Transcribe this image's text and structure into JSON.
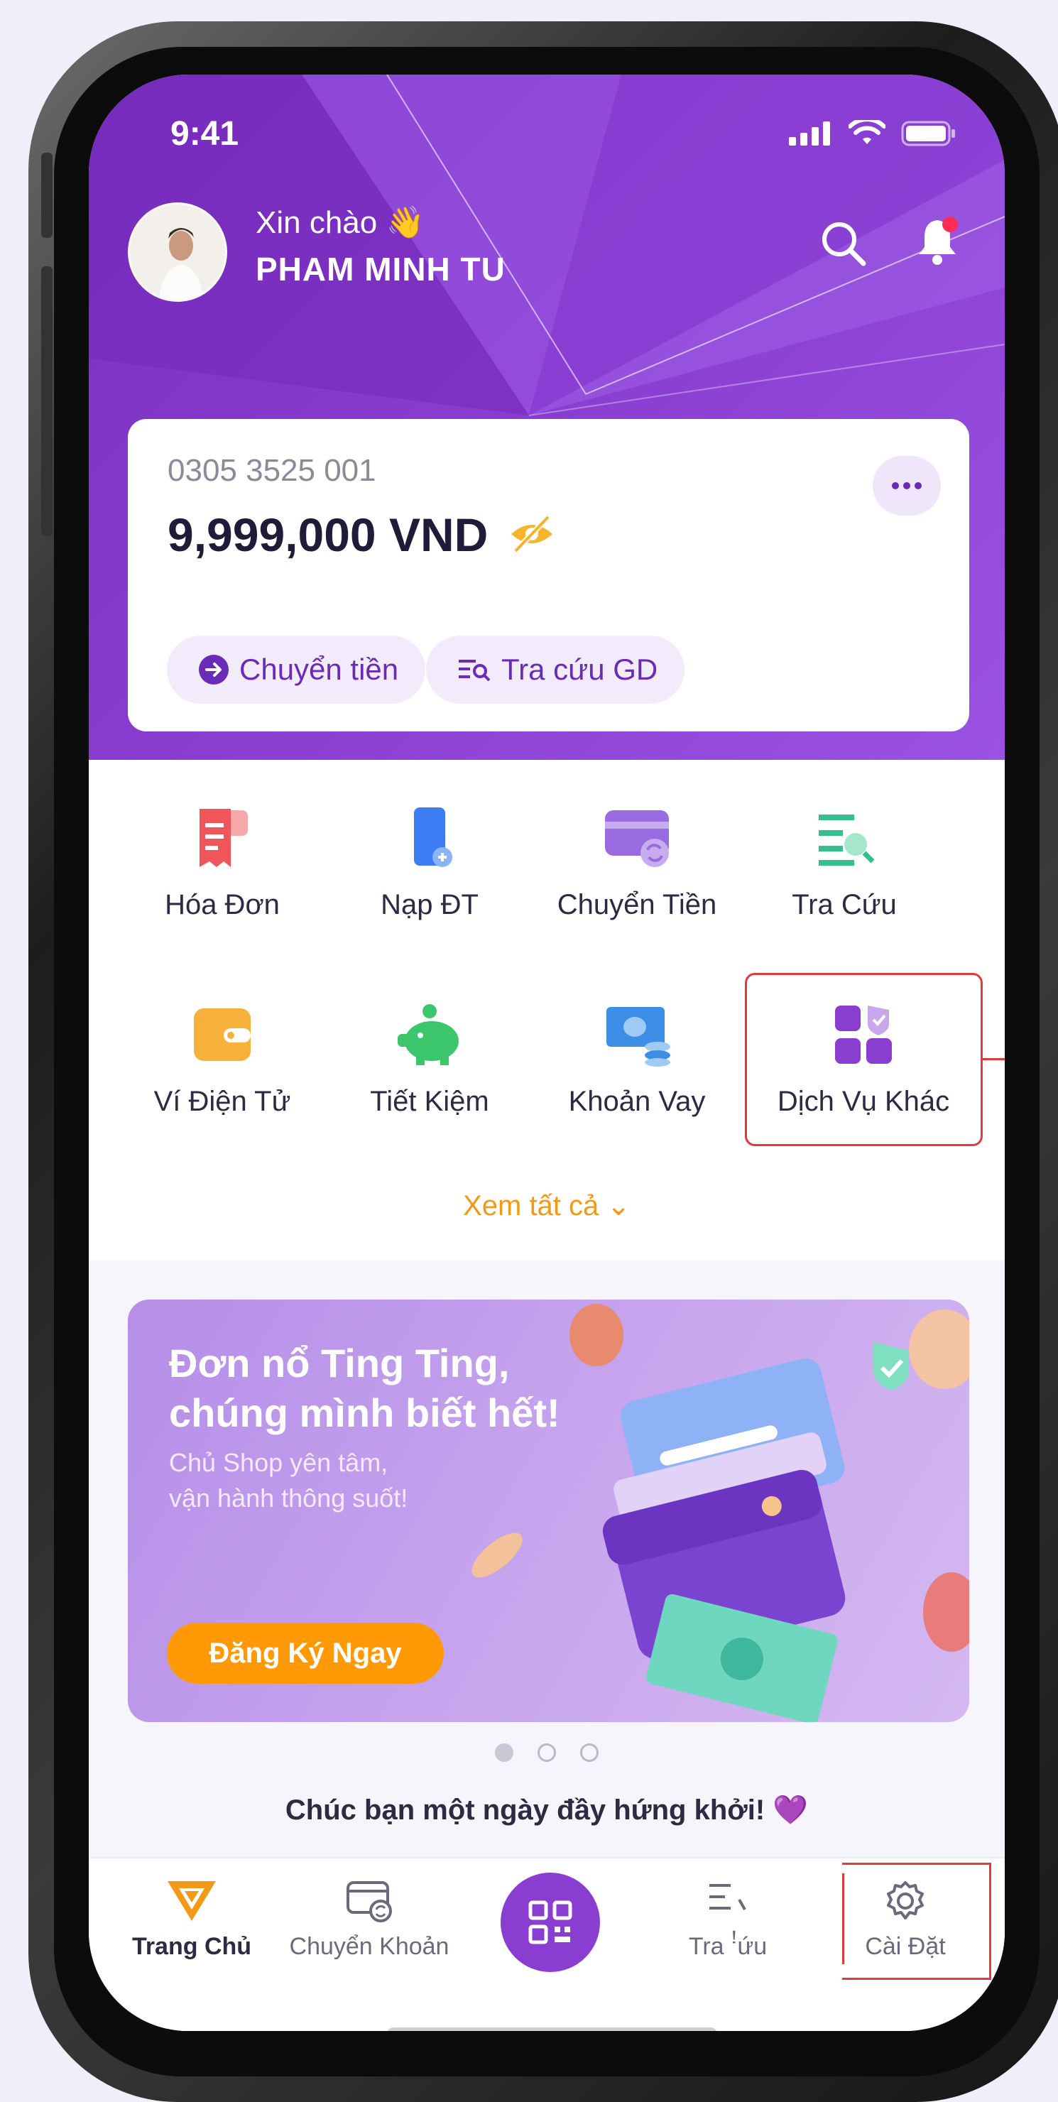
{
  "status": {
    "time": "9:41"
  },
  "header": {
    "greeting": "Xin chào 👋",
    "user_name": "PHAM MINH TU"
  },
  "account": {
    "number": "0305 3525 001",
    "balance": "9,999,000 VND",
    "actions": [
      {
        "label": "Chuyển tiền",
        "icon": "arrow-right-circle-icon"
      },
      {
        "label": "Tra cứu GD",
        "icon": "search-list-icon"
      }
    ]
  },
  "menu": {
    "items": [
      {
        "label": "Hóa Đơn",
        "icon": "bill-icon",
        "color": "#f0555a"
      },
      {
        "label": "Nạp ĐT",
        "icon": "phone-topup-icon",
        "color": "#3d7cf3"
      },
      {
        "label": "Chuyển Tiền",
        "icon": "card-transfer-icon",
        "color": "#9a6be0"
      },
      {
        "label": "Tra Cứu",
        "icon": "lookup-icon",
        "color": "#35c08b"
      },
      {
        "label": "Ví Điện Tử",
        "icon": "wallet-icon",
        "color": "#f6b13b"
      },
      {
        "label": "Tiết Kiệm",
        "icon": "piggy-bank-icon",
        "color": "#3cc66c"
      },
      {
        "label": "Khoản Vay",
        "icon": "loan-icon",
        "color": "#3d8ee6"
      },
      {
        "label": "Dịch Vụ Khác",
        "icon": "other-services-icon",
        "color": "#8a3ed1"
      }
    ],
    "see_all": "Xem tất cả ⌄"
  },
  "banner": {
    "title_line1": "Đơn nổ Ting Ting,",
    "title_line2": "chúng mình biết hết!",
    "subtitle_line1": "Chủ Shop yên tâm,",
    "subtitle_line2": "vận hành thông suốt!",
    "cta": "Đăng Ký Ngay"
  },
  "carousel": {
    "count": 3,
    "active": 0
  },
  "wish": "Chúc bạn một ngày đầy hứng khởi! 💜",
  "tabbar": {
    "items": [
      {
        "label": "Trang Chủ",
        "icon": "home-logo-icon",
        "active": true
      },
      {
        "label": "Chuyển Khoản",
        "icon": "transfer-icon",
        "active": false
      },
      {
        "label": "",
        "icon": "qr-icon",
        "active": false
      },
      {
        "label": "Tra ꜝứu",
        "icon": "search-list-icon",
        "active": false
      },
      {
        "label": "Cài Đặt",
        "icon": "gear-icon",
        "active": false
      }
    ]
  },
  "colors": {
    "primary": "#8a3ed1",
    "accent": "#f29a18",
    "highlight": "#e23a3a"
  }
}
